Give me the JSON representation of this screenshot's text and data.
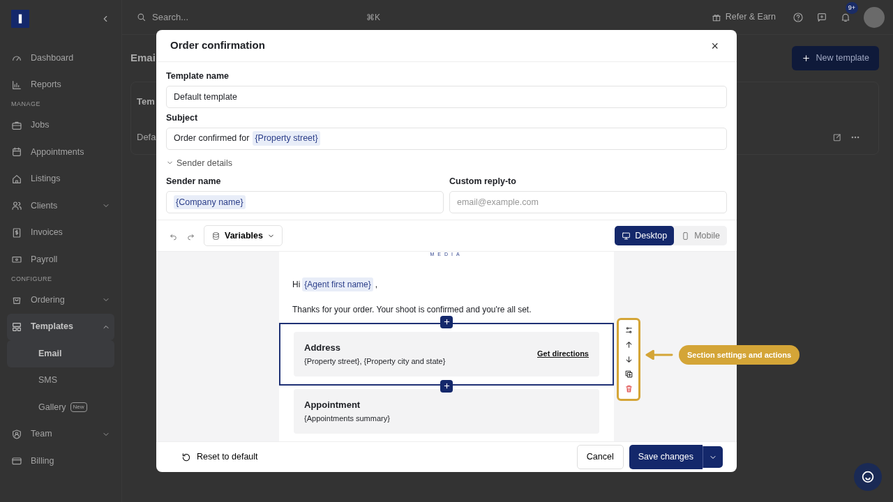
{
  "topbar": {
    "search_placeholder": "Search...",
    "shortcut": "⌘K",
    "refer": "Refer & Earn",
    "notification_count": "9+"
  },
  "sidebar": {
    "groups": [
      {
        "items": [
          {
            "label": "Dashboard",
            "selected": false
          },
          {
            "label": "Reports",
            "selected": false
          }
        ]
      },
      {
        "label": "MANAGE",
        "items": [
          {
            "label": "Jobs",
            "selected": false
          },
          {
            "label": "Appointments",
            "selected": false
          },
          {
            "label": "Listings",
            "selected": false
          },
          {
            "label": "Clients",
            "selected": false,
            "expanded": false
          },
          {
            "label": "Invoices",
            "selected": false
          },
          {
            "label": "Payroll",
            "selected": false
          }
        ]
      },
      {
        "label": "CONFIGURE",
        "items": [
          {
            "label": "Ordering",
            "selected": false,
            "expanded": false
          },
          {
            "label": "Templates",
            "selected": true,
            "expanded": true,
            "children": [
              {
                "label": "Email",
                "selected": true
              },
              {
                "label": "SMS",
                "selected": false
              },
              {
                "label": "Gallery",
                "selected": false,
                "badge": "New"
              }
            ]
          },
          {
            "label": "Team",
            "selected": false,
            "expanded": false
          },
          {
            "label": "Billing",
            "selected": false
          }
        ]
      }
    ]
  },
  "page": {
    "title": "Emai",
    "new_button": "New template",
    "table": {
      "columns": [
        "Tem"
      ],
      "rows": [
        [
          "Defa"
        ]
      ]
    }
  },
  "modal": {
    "title": "Order confirmation",
    "close": "×",
    "fields": [
      {
        "kind": "input",
        "label": "Template name",
        "value": "Default template"
      },
      {
        "kind": "tokens",
        "label": "Subject",
        "parts": [
          {
            "kind": "text",
            "text": "Order confirmed for"
          },
          {
            "kind": "variable",
            "text": "{Property street}"
          }
        ]
      }
    ],
    "sender_details": {
      "label": "Sender details",
      "expanded": true,
      "fields": [
        {
          "kind": "tokens",
          "label": "Sender name",
          "parts": [
            {
              "kind": "variable",
              "text": "{Company name}"
            }
          ]
        },
        {
          "kind": "input",
          "label": "Custom reply-to",
          "placeholder": "email@example.com"
        }
      ]
    },
    "toolbar": {
      "variables": "Variables",
      "views": [
        {
          "label": "Desktop",
          "selected": true
        },
        {
          "label": "Mobile",
          "selected": false
        }
      ]
    },
    "email": {
      "logo_text": "MEDIA",
      "greeting": [
        {
          "kind": "text",
          "text": "Hi"
        },
        {
          "kind": "variable",
          "text": "{Agent first name}"
        },
        {
          "kind": "text",
          "text": ","
        }
      ],
      "intro": "Thanks for your order. Your shoot is confirmed and you're all set.",
      "sections": [
        {
          "title": "Address",
          "body": "{Property street}, {Property city and state}",
          "link": "Get directions",
          "selected": true
        },
        {
          "title": "Appointment",
          "body": "{Appointments summary}",
          "selected": false
        }
      ]
    },
    "footer": {
      "reset": "Reset to default",
      "cancel": "Cancel",
      "save": "Save changes"
    }
  },
  "annotation": {
    "text": "Section settings and actions"
  }
}
